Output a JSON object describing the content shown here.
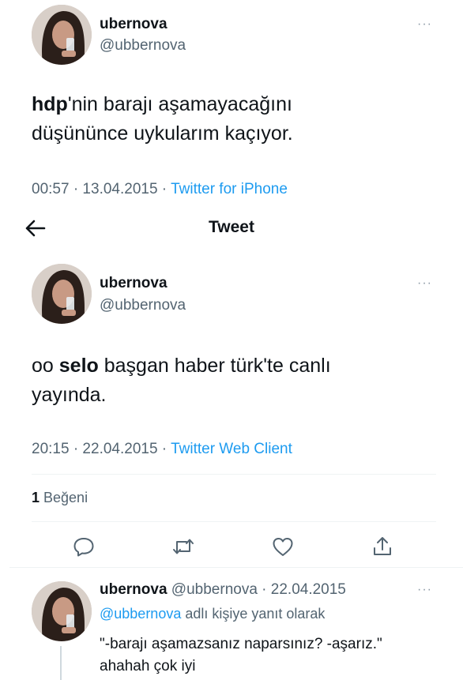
{
  "tweet1": {
    "name": "ubernova",
    "handle": "@ubbernova",
    "text_bold": "hdp",
    "text_line1_rest": "'nin barajı aşamayacağını",
    "text_line2": "düşününce uykularım kaçıyor.",
    "time": "00:57 · 13.04.2015 · ",
    "source": "Twitter for iPhone",
    "more": "···"
  },
  "header": {
    "title": "Tweet",
    "back_icon": "arrow-left-icon"
  },
  "tweet2": {
    "name": "ubernova",
    "handle": "@ubbernova",
    "text_prefix": "oo ",
    "text_bold": "selo",
    "text_line1_rest": " başgan haber türk'te canlı",
    "text_line2": "yayında.",
    "time": "20:15 · 22.04.2015 · ",
    "source": "Twitter Web Client",
    "more": "···",
    "likes_count": "1",
    "likes_label": " Beğeni"
  },
  "actions": {
    "icons": [
      "reply-icon",
      "retweet-icon",
      "like-icon",
      "share-icon"
    ]
  },
  "reply": {
    "name": "ubernova",
    "meta": " @ubbernova · 22.04.2015",
    "mention": "@ubbernova",
    "reply_label": " adlı kişiye yanıt olarak",
    "line1": "\"-barajı aşamazsanız naparsınız? -aşarız.\"",
    "line2": "ahahah çok iyi",
    "more": "···"
  },
  "colors": {
    "link": "#1d9bf0",
    "muted": "#536471",
    "text": "#0f1419",
    "divider": "#eff3f4"
  }
}
